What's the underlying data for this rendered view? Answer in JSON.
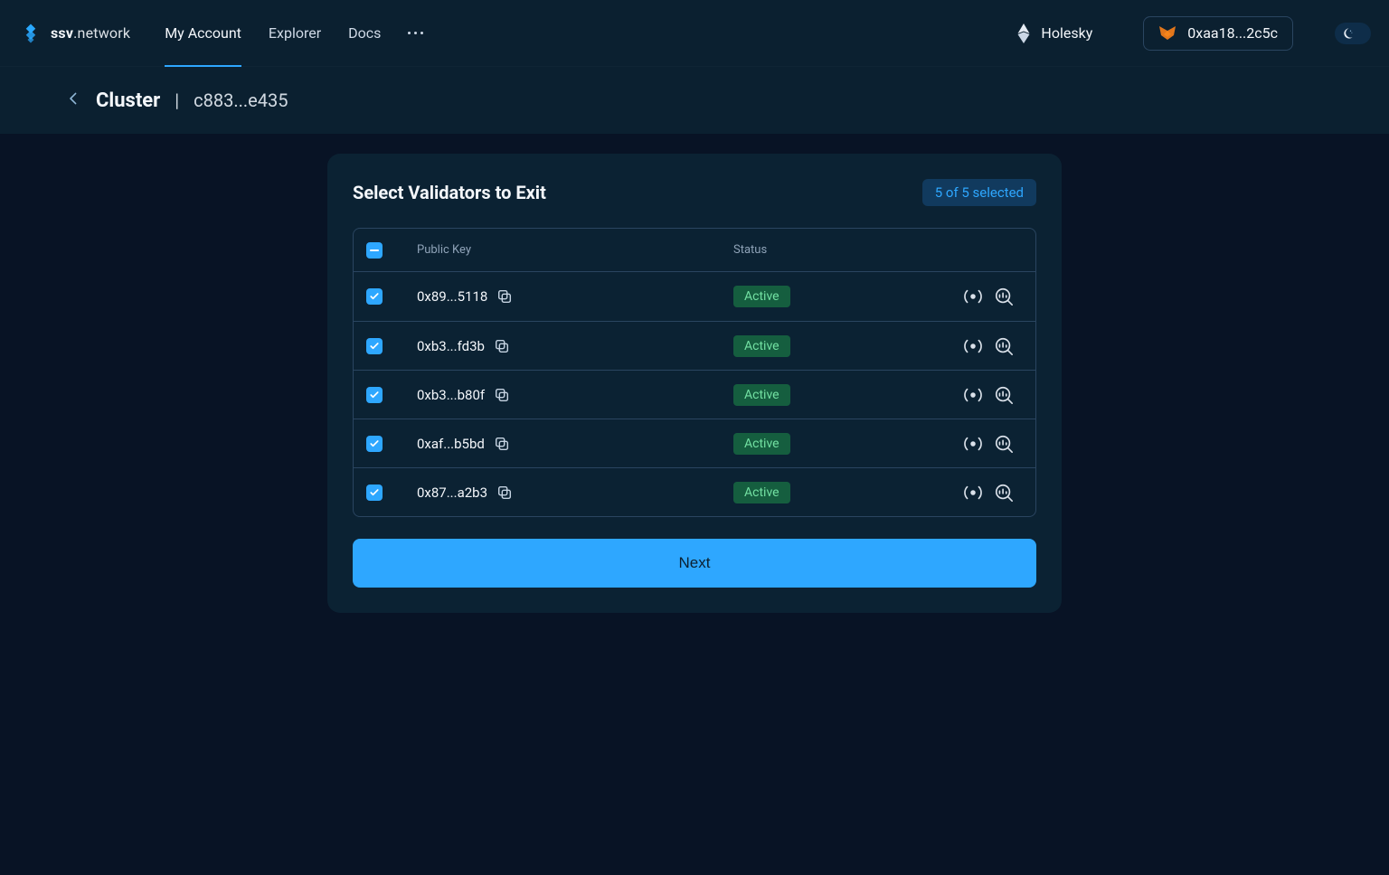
{
  "brand": {
    "bold": "ssv",
    "thin": ".network"
  },
  "nav": {
    "items": [
      "My Account",
      "Explorer",
      "Docs"
    ],
    "active_index": 0,
    "network": "Holesky",
    "wallet_address": "0xaa18...2c5c"
  },
  "breadcrumb": {
    "title": "Cluster",
    "sep": "|",
    "id": "c883...e435"
  },
  "card": {
    "title": "Select Validators to Exit",
    "selection_badge": "5 of 5 selected",
    "columns": {
      "pk": "Public Key",
      "status": "Status"
    },
    "rows": [
      {
        "pk": "0x89...5118",
        "status": "Active"
      },
      {
        "pk": "0xb3...fd3b",
        "status": "Active"
      },
      {
        "pk": "0xb3...b80f",
        "status": "Active"
      },
      {
        "pk": "0xaf...b5bd",
        "status": "Active"
      },
      {
        "pk": "0x87...a2b3",
        "status": "Active"
      }
    ],
    "next_label": "Next"
  }
}
